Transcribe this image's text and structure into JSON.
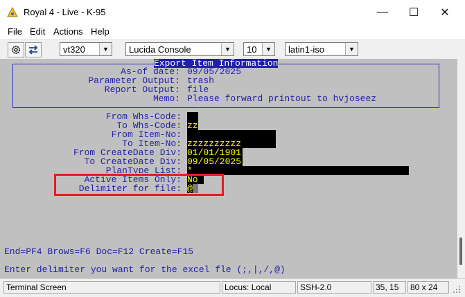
{
  "window": {
    "title": "Royal 4 - Live - K-95",
    "minimize_glyph": "—",
    "maximize_glyph": "☐",
    "close_glyph": "✕"
  },
  "menu": [
    "File",
    "Edit",
    "Actions",
    "Help"
  ],
  "toolbar": {
    "terminal_type": "vt320",
    "font": "Lucida Console",
    "font_size": "10",
    "charset": "latin1-iso"
  },
  "terminal": {
    "box_title": "Export Item Information",
    "header_fields": [
      {
        "label": "As-of date:",
        "value": "09/05/2025"
      },
      {
        "label": "Parameter Output:",
        "value": "trash"
      },
      {
        "label": "Report Output:",
        "value": "file"
      },
      {
        "label": "Memo:",
        "value": "Please forward printout to hvjoseez"
      }
    ],
    "fields": [
      {
        "label": "From Whs-Code:",
        "value": ""
      },
      {
        "label": "To Whs-Code:",
        "value": "zz"
      },
      {
        "label": "From Item-No:",
        "value": ""
      },
      {
        "label": "To Item-No:",
        "value": "zzzzzzzzzz"
      },
      {
        "label": "From CreateDate Div:",
        "value": "01/01/1901"
      },
      {
        "label": "To CreateDate Div:",
        "value": "09/05/2025"
      },
      {
        "label": "PlanType List:",
        "value": "*"
      },
      {
        "label": "Active Items Only:",
        "value": "No"
      },
      {
        "label": "Delimiter for file:",
        "value": "@"
      }
    ],
    "function_keys": "End=PF4 Brows=F6 Doc=F12 Create=F15",
    "prompt": "Enter delimiter you want for the excel fle (;,|,/,@)"
  },
  "status": {
    "screen": "Terminal Screen",
    "locus": "Locus: Local",
    "protocol": "SSH-2.0",
    "cursor_pos": "35, 15",
    "size": "80 x 24"
  },
  "colors": {
    "terminal_bg": "#c0c0c0",
    "label_text": "#2020a8",
    "field_bg": "#000000",
    "field_text": "#ffff00",
    "highlight_box": "#e02020"
  }
}
